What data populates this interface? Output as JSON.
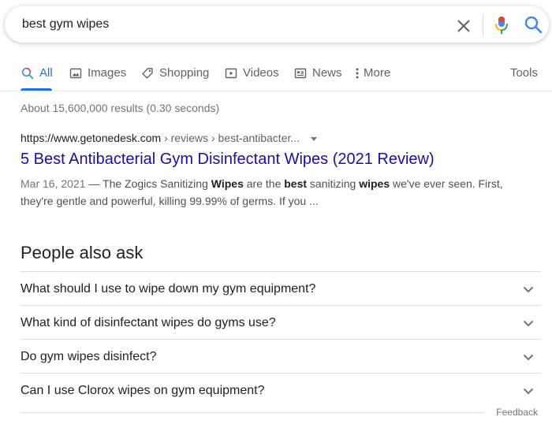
{
  "search": {
    "query": "best gym wipes",
    "icons": [
      "clear-icon",
      "microphone-icon",
      "search-icon"
    ]
  },
  "tabs": [
    {
      "label": "All",
      "icon": "search-icon",
      "active": true
    },
    {
      "label": "Images",
      "icon": "image-icon"
    },
    {
      "label": "Shopping",
      "icon": "tag-icon"
    },
    {
      "label": "Videos",
      "icon": "play-icon"
    },
    {
      "label": "News",
      "icon": "news-icon"
    },
    {
      "label": "More",
      "icon": "kebab-icon"
    }
  ],
  "tools_label": "Tools",
  "stats": "About 15,600,000 results (0.30 seconds)",
  "result": {
    "cite_domain": "https://www.getonedesk.com",
    "cite_path": " › reviews › best-antibacter...",
    "title": "5 Best Antibacterial Gym Disinfectant Wipes (2021 Review)",
    "date": "Mar 16, 2021",
    "snippet_parts": [
      {
        "text": " — The Zogics Sanitizing ",
        "bold": false
      },
      {
        "text": "Wipes",
        "bold": true
      },
      {
        "text": " are the ",
        "bold": false
      },
      {
        "text": "best",
        "bold": true
      },
      {
        "text": " sanitizing ",
        "bold": false
      },
      {
        "text": "wipes",
        "bold": true
      },
      {
        "text": " we've ever seen. First, they're gentle and powerful, killing 99.99% of germs. If you ...",
        "bold": false
      }
    ]
  },
  "people_also_ask": {
    "title": "People also ask",
    "questions": [
      "What should I use to wipe down my gym equipment?",
      "What kind of disinfectant wipes do gyms use?",
      "Do gym wipes disinfect?",
      "Can I use Clorox wipes on gym equipment?"
    ]
  },
  "feedback_label": "Feedback",
  "colors": {
    "link_title": "#1a0dab",
    "active_tab": "#1a73e8",
    "mic_blue": "#4285f4",
    "mic_red": "#ea4335",
    "mic_yellow": "#fbbc04",
    "mic_green": "#34a853"
  }
}
